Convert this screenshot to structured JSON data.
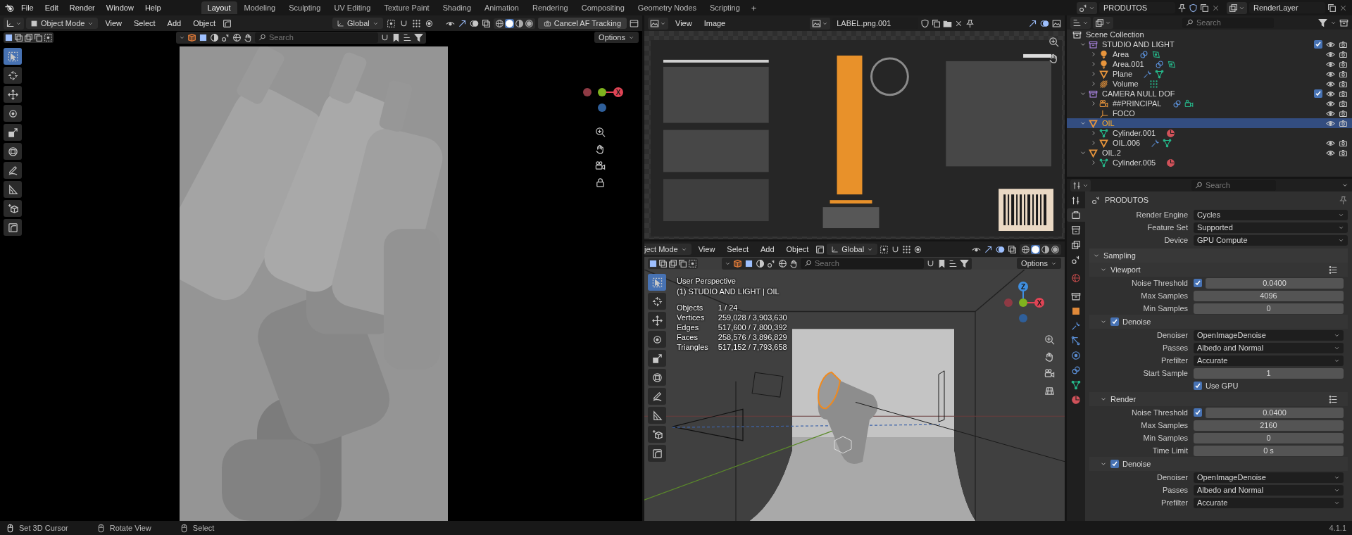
{
  "topbar": {
    "menus": [
      "File",
      "Edit",
      "Render",
      "Window",
      "Help"
    ],
    "workspaces": [
      {
        "label": "Layout",
        "selected": true
      },
      {
        "label": "Modeling",
        "selected": false
      },
      {
        "label": "Sculpting",
        "selected": false
      },
      {
        "label": "UV Editing",
        "selected": false
      },
      {
        "label": "Texture Paint",
        "selected": false
      },
      {
        "label": "Shading",
        "selected": false
      },
      {
        "label": "Animation",
        "selected": false
      },
      {
        "label": "Rendering",
        "selected": false
      },
      {
        "label": "Compositing",
        "selected": false
      },
      {
        "label": "Geometry Nodes",
        "selected": false
      },
      {
        "label": "Scripting",
        "selected": false
      }
    ],
    "add_workspace": "+",
    "scene": "PRODUTOS",
    "view_layer": "RenderLayer"
  },
  "left_viewport": {
    "mode": "Object Mode",
    "menus": [
      "View",
      "Select",
      "Add",
      "Object"
    ],
    "orientation": "Global",
    "tracking_button": "Cancel AF Tracking",
    "search": {
      "placeholder": "Search"
    },
    "options": "Options",
    "shading": [
      {
        "selected": false
      },
      {
        "selected": true
      },
      {
        "selected": false
      },
      {
        "selected": false
      }
    ],
    "tools": [
      {
        "kind": "select",
        "selected": true
      },
      {
        "kind": "cursor",
        "selected": false
      },
      {
        "kind": "move",
        "selected": false
      },
      {
        "kind": "rotate",
        "selected": false
      },
      {
        "kind": "scale",
        "selected": false
      },
      {
        "kind": "transform",
        "selected": false
      },
      {
        "kind": "annotate",
        "selected": false
      },
      {
        "kind": "measure",
        "selected": false
      },
      {
        "kind": "add_cube",
        "selected": false
      },
      {
        "kind": "bevel",
        "selected": false
      }
    ],
    "gizmo": [
      "X"
    ]
  },
  "image_editor": {
    "menus": [
      "View",
      "Image"
    ],
    "image_name": "LABEL.png.001"
  },
  "right_viewport": {
    "mode": "ject Mode",
    "menus": [
      "View",
      "Select",
      "Add",
      "Object"
    ],
    "orientation": "Global",
    "search": {
      "placeholder": "Search"
    },
    "options": "Options",
    "shading": [
      {
        "selected": false
      },
      {
        "selected": true
      },
      {
        "selected": false
      },
      {
        "selected": false
      }
    ],
    "view_name": "User Perspective",
    "collection_info": "(1) STUDIO AND LIGHT | OIL",
    "stats": [
      {
        "label": "Objects",
        "value": "1 / 24"
      },
      {
        "label": "Vertices",
        "value": "259,028 / 3,903,630"
      },
      {
        "label": "Edges",
        "value": "517,600 / 7,800,392"
      },
      {
        "label": "Faces",
        "value": "258,576 / 3,896,829"
      },
      {
        "label": "Triangles",
        "value": "517,152 / 7,793,658"
      }
    ],
    "tools": [
      {
        "kind": "select",
        "selected": true
      },
      {
        "kind": "cursor",
        "selected": false
      },
      {
        "kind": "move",
        "selected": false
      },
      {
        "kind": "rotate",
        "selected": false
      },
      {
        "kind": "scale",
        "selected": false
      },
      {
        "kind": "transform",
        "selected": false
      },
      {
        "kind": "annotate",
        "selected": false
      },
      {
        "kind": "measure",
        "selected": false
      },
      {
        "kind": "add_cube",
        "selected": false
      },
      {
        "kind": "bevel",
        "selected": false
      }
    ],
    "gizmo": [
      "Z",
      "X"
    ]
  },
  "outliner": {
    "search": {
      "placeholder": "Search"
    },
    "root": "Scene Collection",
    "items": [
      {
        "name": "STUDIO AND LIGHT",
        "kind": "collection",
        "expanded": true,
        "selected": false,
        "checked": true,
        "restrictions": true,
        "children": [
          {
            "name": "Area",
            "kind": "light",
            "expanded": false,
            "selected": false,
            "restrictions": true
          },
          {
            "name": "Area.001",
            "kind": "light",
            "expanded": false,
            "selected": false,
            "restrictions": true
          },
          {
            "name": "Plane",
            "kind": "mesh",
            "expanded": false,
            "selected": false,
            "restrictions": true
          },
          {
            "name": "Volume",
            "kind": "volume",
            "expanded": false,
            "selected": false,
            "restrictions": true
          }
        ]
      },
      {
        "name": "CAMERA NULL DOF",
        "kind": "collection",
        "expanded": true,
        "selected": false,
        "checked": true,
        "restrictions": true,
        "children": [
          {
            "name": "##PRINCIPAL",
            "kind": "camera",
            "expanded": false,
            "selected": false,
            "restrictions": true
          },
          {
            "name": "FOCO",
            "kind": "empty",
            "selected": false,
            "restrictions": true
          }
        ]
      },
      {
        "name": "OIL",
        "kind": "mesh",
        "expanded": true,
        "selected": true,
        "restrictions": true,
        "children": [
          {
            "name": "Cylinder.001",
            "kind": "mesh_data",
            "expanded": false,
            "selected": false,
            "restrictions": false
          },
          {
            "name": "OIL.006",
            "kind": "mesh",
            "expanded": false,
            "selected": false,
            "restrictions": true
          }
        ]
      },
      {
        "name": "OIL.2",
        "kind": "mesh",
        "expanded": true,
        "selected": false,
        "restrictions": true,
        "children": [
          {
            "name": "Cylinder.005",
            "kind": "mesh_data",
            "expanded": false,
            "selected": false,
            "restrictions": false
          }
        ]
      }
    ]
  },
  "properties": {
    "search": {
      "placeholder": "Search"
    },
    "title": "PRODUTOS",
    "tabs": [
      {
        "kind": "tool",
        "selected": false
      },
      {
        "kind": "render",
        "selected": true
      },
      {
        "kind": "output",
        "selected": false
      },
      {
        "kind": "view_layer",
        "selected": false
      },
      {
        "kind": "scene",
        "selected": false
      },
      {
        "kind": "world",
        "selected": false
      },
      {
        "kind": "collection",
        "selected": false
      },
      {
        "kind": "object",
        "selected": false
      },
      {
        "kind": "modifiers",
        "selected": false
      },
      {
        "kind": "particles",
        "selected": false
      },
      {
        "kind": "physics",
        "selected": false
      },
      {
        "kind": "constraints",
        "selected": false
      },
      {
        "kind": "data",
        "selected": false
      },
      {
        "kind": "material",
        "selected": false
      }
    ],
    "rows": [
      {
        "kind": "dropdown",
        "label": "Render Engine",
        "value": "Cycles"
      },
      {
        "kind": "dropdown",
        "label": "Feature Set",
        "value": "Supported"
      },
      {
        "kind": "dropdown",
        "label": "Device",
        "value": "GPU Compute"
      },
      {
        "kind": "panel",
        "label": "Sampling",
        "expanded": true
      },
      {
        "kind": "subpanel",
        "label": "Viewport",
        "expanded": true
      },
      {
        "kind": "check_number",
        "label": "Noise Threshold",
        "checked": true,
        "value": "0.0400"
      },
      {
        "kind": "number",
        "label": "Max Samples",
        "value": "4096"
      },
      {
        "kind": "number",
        "label": "Min Samples",
        "value": "0"
      },
      {
        "kind": "subpanel_check",
        "label": "Denoise",
        "expanded": true,
        "checked": true
      },
      {
        "kind": "dropdown",
        "label": "Denoiser",
        "value": "OpenImageDenoise"
      },
      {
        "kind": "dropdown",
        "label": "Passes",
        "value": "Albedo and Normal"
      },
      {
        "kind": "dropdown",
        "label": "Prefilter",
        "value": "Accurate"
      },
      {
        "kind": "number",
        "label": "Start Sample",
        "value": "1"
      },
      {
        "kind": "checkbox",
        "label": "Use GPU",
        "checked": true
      },
      {
        "kind": "subpanel",
        "label": "Render",
        "expanded": true
      },
      {
        "kind": "check_number",
        "label": "Noise Threshold",
        "checked": true,
        "value": "0.0400"
      },
      {
        "kind": "number",
        "label": "Max Samples",
        "value": "2160"
      },
      {
        "kind": "number",
        "label": "Min Samples",
        "value": "0"
      },
      {
        "kind": "number",
        "label": "Time Limit",
        "value": "0 s"
      },
      {
        "kind": "subpanel_check",
        "label": "Denoise",
        "expanded": true,
        "checked": true
      },
      {
        "kind": "dropdown",
        "label": "Denoiser",
        "value": "OpenImageDenoise"
      },
      {
        "kind": "dropdown",
        "label": "Passes",
        "value": "Albedo and Normal"
      },
      {
        "kind": "dropdown",
        "label": "Prefilter",
        "value": "Accurate"
      }
    ]
  },
  "status_bar": {
    "items": [
      {
        "kind": "left_click",
        "label": "Set 3D Cursor"
      },
      {
        "kind": "middle_click",
        "label": "Rotate View"
      },
      {
        "kind": "right_click",
        "label": "Select"
      }
    ],
    "version": "4.1.1"
  }
}
